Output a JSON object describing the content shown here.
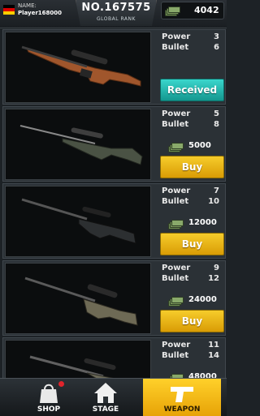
{
  "header": {
    "name_label": "NAME:",
    "player_name": "Player168000",
    "rank_number": "NO.167575",
    "rank_label": "GLOBAL RANK",
    "money": "4042",
    "flag_colors": [
      "#000000",
      "#dd0000",
      "#ffce00"
    ]
  },
  "weapons": [
    {
      "power_label": "Power",
      "power": "3",
      "bullet_label": "Bullet",
      "bullet": "6",
      "state": "received",
      "button_label": "Received",
      "price": ""
    },
    {
      "power_label": "Power",
      "power": "5",
      "bullet_label": "Bullet",
      "bullet": "8",
      "state": "buy",
      "button_label": "Buy",
      "price": "5000"
    },
    {
      "power_label": "Power",
      "power": "7",
      "bullet_label": "Bullet",
      "bullet": "10",
      "state": "buy",
      "button_label": "Buy",
      "price": "12000"
    },
    {
      "power_label": "Power",
      "power": "9",
      "bullet_label": "Bullet",
      "bullet": "12",
      "state": "buy",
      "button_label": "Buy",
      "price": "24000"
    },
    {
      "power_label": "Power",
      "power": "11",
      "bullet_label": "Bullet",
      "bullet": "14",
      "state": "buy",
      "button_label": "",
      "price": "48000"
    }
  ],
  "nav": {
    "shop": "SHOP",
    "stage": "STAGE",
    "weapon": "WEAPON",
    "active": "weapon"
  },
  "colors": {
    "buy_button": "#f0b81a",
    "received_button": "#22b7ae",
    "notification_dot": "#e0242c"
  }
}
